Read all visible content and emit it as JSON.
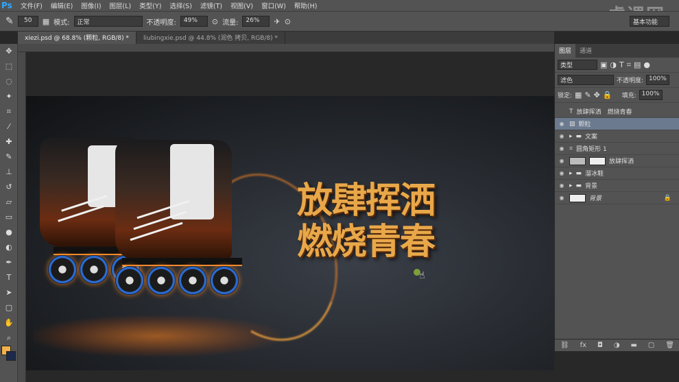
{
  "app": {
    "logo": "Ps",
    "watermark": "虎课网"
  },
  "menu": [
    "文件(F)",
    "编辑(E)",
    "图像(I)",
    "图层(L)",
    "类型(Y)",
    "选择(S)",
    "滤镜(T)",
    "视图(V)",
    "窗口(W)",
    "帮助(H)"
  ],
  "options": {
    "brush_size": "50",
    "mode_label": "模式:",
    "mode_value": "正常",
    "opacity_label": "不透明度:",
    "opacity_value": "49%",
    "flow_label": "流量:",
    "flow_value": "26%",
    "workspace": "基本功能"
  },
  "tabs": [
    {
      "label": "xiezi.psd @ 68.8% (颗粒, RGB/8) *"
    },
    {
      "label": "liubingxie.psd @ 44.8% (润色 拷贝, RGB/8) *"
    }
  ],
  "canvas": {
    "headline_line1": "放肆挥洒",
    "headline_line2": "燃烧青春"
  },
  "layers_panel": {
    "tabs": [
      "图层",
      "通道"
    ],
    "filter_kind": "类型",
    "blend_mode": "滤色",
    "opacity_label": "不透明度:",
    "opacity_value": "100%",
    "lock_label": "锁定:",
    "fill_label": "填充:",
    "fill_value": "100%",
    "layers": [
      {
        "name": "放肆挥洒　燃烧青春",
        "type": "text",
        "visible": false
      },
      {
        "name": "颗粒",
        "type": "smart",
        "visible": true,
        "selected": true
      },
      {
        "name": "文案",
        "type": "group",
        "visible": true
      },
      {
        "name": "圆角矩形 1",
        "type": "shape",
        "visible": true
      },
      {
        "name": "放肆挥洒",
        "type": "masked",
        "visible": true
      },
      {
        "name": "溜冰鞋",
        "type": "group",
        "visible": true
      },
      {
        "name": "背景",
        "type": "group",
        "visible": true
      },
      {
        "name": "背景",
        "type": "background",
        "visible": true,
        "locked": true
      }
    ]
  },
  "colors": {
    "foreground": "#f4b04a",
    "background": "#1e2a4a"
  }
}
